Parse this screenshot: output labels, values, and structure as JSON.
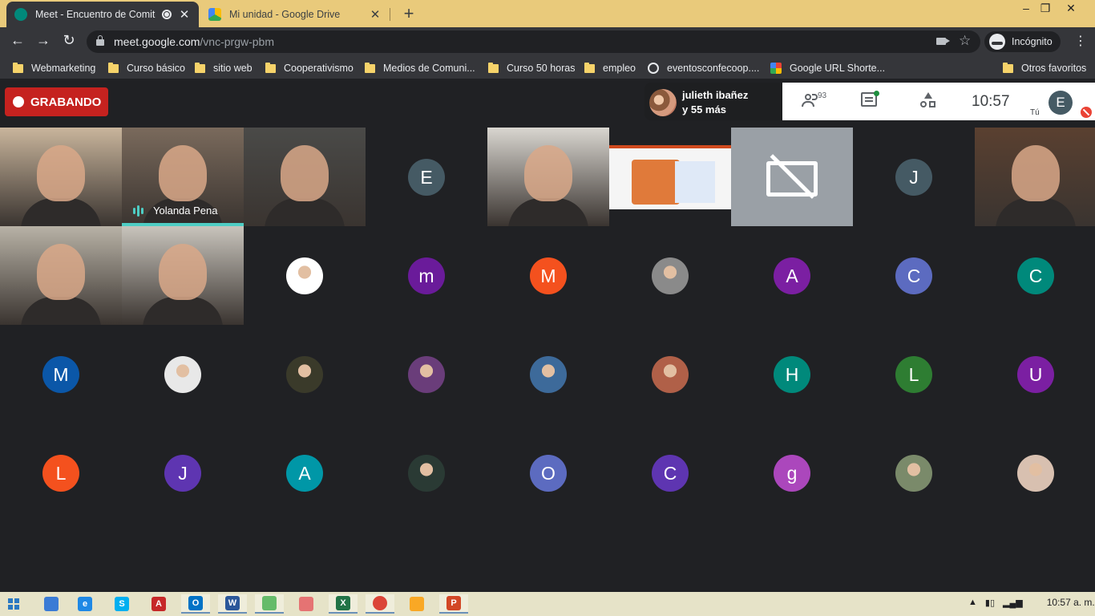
{
  "browser": {
    "tabs": [
      {
        "title": "Meet - Encuentro de Comité",
        "active": true
      },
      {
        "title": "Mi unidad - Google Drive",
        "active": false
      }
    ],
    "new_tab": "+",
    "window_controls": {
      "minimize": "–",
      "maximize": "❐",
      "close": "✕"
    },
    "nav": {
      "back": "←",
      "forward": "→",
      "reload": "↻"
    },
    "url": {
      "host": "meet.google.com",
      "path": "/vnc-prgw-pbm"
    },
    "incognito_label": "Incógnito",
    "menu": "⋮"
  },
  "bookmarks": [
    {
      "label": "Webmarketing",
      "icon": "folder-icon"
    },
    {
      "label": "Curso básico",
      "icon": "folder-icon"
    },
    {
      "label": "sitio web",
      "icon": "folder-icon"
    },
    {
      "label": "Cooperativismo",
      "icon": "folder-icon"
    },
    {
      "label": "Medios de Comuni...",
      "icon": "folder-icon"
    },
    {
      "label": "Curso 50 horas",
      "icon": "folder-icon"
    },
    {
      "label": "empleo",
      "icon": "folder-icon"
    },
    {
      "label": "eventosconfecoop....",
      "icon": "globe-icon"
    },
    {
      "label": "Google URL Shorte...",
      "icon": "google-url-icon"
    },
    {
      "label": "Otros favoritos",
      "icon": "folder-icon"
    }
  ],
  "meet": {
    "recording_label": "GRABANDO",
    "presenter": {
      "name": "julieth ibañez",
      "others": "y 55 más"
    },
    "people_count": "93",
    "clock": "10:57",
    "self_initial": "E",
    "self_label": "Tú",
    "active_speaker": "Yolanda Pena",
    "tiles": [
      {
        "kind": "video",
        "name": "video-participant-1",
        "bg": "#c9b59c"
      },
      {
        "kind": "video",
        "name": "video-participant-yolanda",
        "bg": "#7a6a5c",
        "speaking": true
      },
      {
        "kind": "video",
        "name": "video-participant-3",
        "bg": "#4a4a48"
      },
      {
        "kind": "avatar",
        "letter": "E",
        "color": "#455a64"
      },
      {
        "kind": "video",
        "name": "video-participant-5",
        "bg": "#d9d6d0"
      },
      {
        "kind": "slide",
        "name": "shared-presentation"
      },
      {
        "kind": "camera-off",
        "name": "camera-off-tile"
      },
      {
        "kind": "avatar",
        "letter": "J",
        "color": "#455a64"
      },
      {
        "kind": "video",
        "name": "video-participant-9",
        "bg": "#5a4030"
      },
      {
        "kind": "video",
        "name": "video-participant-10",
        "bg": "#b8b2a6"
      },
      {
        "kind": "video",
        "name": "video-participant-11",
        "bg": "#c8c4bc"
      },
      {
        "kind": "photo",
        "name": "logo-30-avatar",
        "color": "#ffffff"
      },
      {
        "kind": "avatar",
        "letter": "m",
        "color": "#6a1b9a"
      },
      {
        "kind": "avatar",
        "letter": "M",
        "color": "#f4511e"
      },
      {
        "kind": "photo",
        "name": "photo-avatar-man",
        "color": "#8a8a8a"
      },
      {
        "kind": "avatar",
        "letter": "A",
        "color": "#7b1fa2"
      },
      {
        "kind": "avatar",
        "letter": "C",
        "color": "#5c6bc0"
      },
      {
        "kind": "avatar",
        "letter": "C",
        "color": "#00897b"
      },
      {
        "kind": "avatar",
        "letter": "M",
        "color": "#0b57a8"
      },
      {
        "kind": "photo",
        "name": "photo-avatar-woman-1",
        "color": "#e8e8e8"
      },
      {
        "kind": "photo",
        "name": "photo-avatar-woman-2",
        "color": "#3a3a2a"
      },
      {
        "kind": "photo",
        "name": "photo-avatar-purple-text",
        "color": "#6a3d7a"
      },
      {
        "kind": "photo",
        "name": "photo-avatar-tree",
        "color": "#3d6a9a"
      },
      {
        "kind": "photo",
        "name": "photo-avatar-woman-3",
        "color": "#b06048"
      },
      {
        "kind": "avatar",
        "letter": "H",
        "color": "#00897b"
      },
      {
        "kind": "avatar",
        "letter": "L",
        "color": "#2e7d32"
      },
      {
        "kind": "avatar",
        "letter": "U",
        "color": "#7b1fa2"
      },
      {
        "kind": "avatar",
        "letter": "L",
        "color": "#f4511e"
      },
      {
        "kind": "avatar",
        "letter": "J",
        "color": "#5e35b1"
      },
      {
        "kind": "avatar",
        "letter": "A",
        "color": "#0097a7"
      },
      {
        "kind": "photo",
        "name": "photo-avatar-dark-logo",
        "color": "#2a3a34"
      },
      {
        "kind": "avatar",
        "letter": "O",
        "color": "#5c6bc0"
      },
      {
        "kind": "avatar",
        "letter": "C",
        "color": "#5e35b1"
      },
      {
        "kind": "avatar",
        "letter": "g",
        "color": "#ab47bc"
      },
      {
        "kind": "photo",
        "name": "photo-avatar-landscape",
        "color": "#7a8a6a"
      },
      {
        "kind": "photo",
        "name": "photo-avatar-woman-4",
        "color": "#d8c0b0"
      }
    ]
  },
  "taskbar": {
    "apps": [
      {
        "name": "start-menu",
        "glyph": ""
      },
      {
        "name": "app-generic",
        "glyph": "",
        "color": "#3a7bd5"
      },
      {
        "name": "internet-explorer",
        "glyph": "e",
        "color": "#1e88e5"
      },
      {
        "name": "skype",
        "glyph": "S",
        "color": "#00aff0"
      },
      {
        "name": "acrobat",
        "glyph": "A",
        "color": "#c62828"
      },
      {
        "name": "outlook",
        "glyph": "O",
        "color": "#0072c6",
        "open": true
      },
      {
        "name": "word",
        "glyph": "W",
        "color": "#2b579a",
        "open": true
      },
      {
        "name": "app-green",
        "glyph": "",
        "color": "#66bb6a",
        "open": true
      },
      {
        "name": "paint",
        "glyph": "",
        "color": "#e57373"
      },
      {
        "name": "excel",
        "glyph": "X",
        "color": "#217346",
        "open": true
      },
      {
        "name": "chrome",
        "glyph": "",
        "color": "#db4437",
        "open": true
      },
      {
        "name": "file-explorer",
        "glyph": "",
        "color": "#f9a825"
      },
      {
        "name": "powerpoint",
        "glyph": "P",
        "color": "#d24726",
        "open": true
      }
    ],
    "tray_time": "10:57 a. m."
  }
}
